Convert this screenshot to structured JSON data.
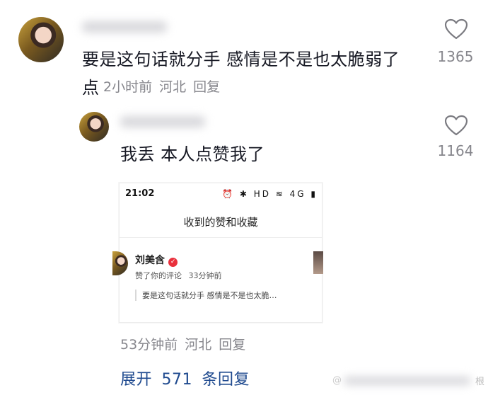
{
  "comment": {
    "text_line1": "要是这句话就分手 感情是不是也太脆弱了",
    "text_line2": "点",
    "time": "2小时前",
    "location": "河北",
    "reply": "回复",
    "likes": "1365"
  },
  "reply_comment": {
    "text": "我丢 本人点赞我了",
    "likes": "1164",
    "time": "53分钟前",
    "location": "河北",
    "reply": "回复"
  },
  "screenshot": {
    "status_time": "21:02",
    "status_icons": "⏰ ✱ HD ≋ 4G ▮",
    "title": "收到的赞和收藏",
    "user_name": "刘美含",
    "verified_mark": "✓",
    "action": "赞了你的评论",
    "action_time": "33分钟前",
    "quoted": "要是这句话就分手 感情是不是也太脆…"
  },
  "expand": {
    "label_pre": "展开",
    "count": "571",
    "label_post": "条回复"
  },
  "watermark": "根"
}
